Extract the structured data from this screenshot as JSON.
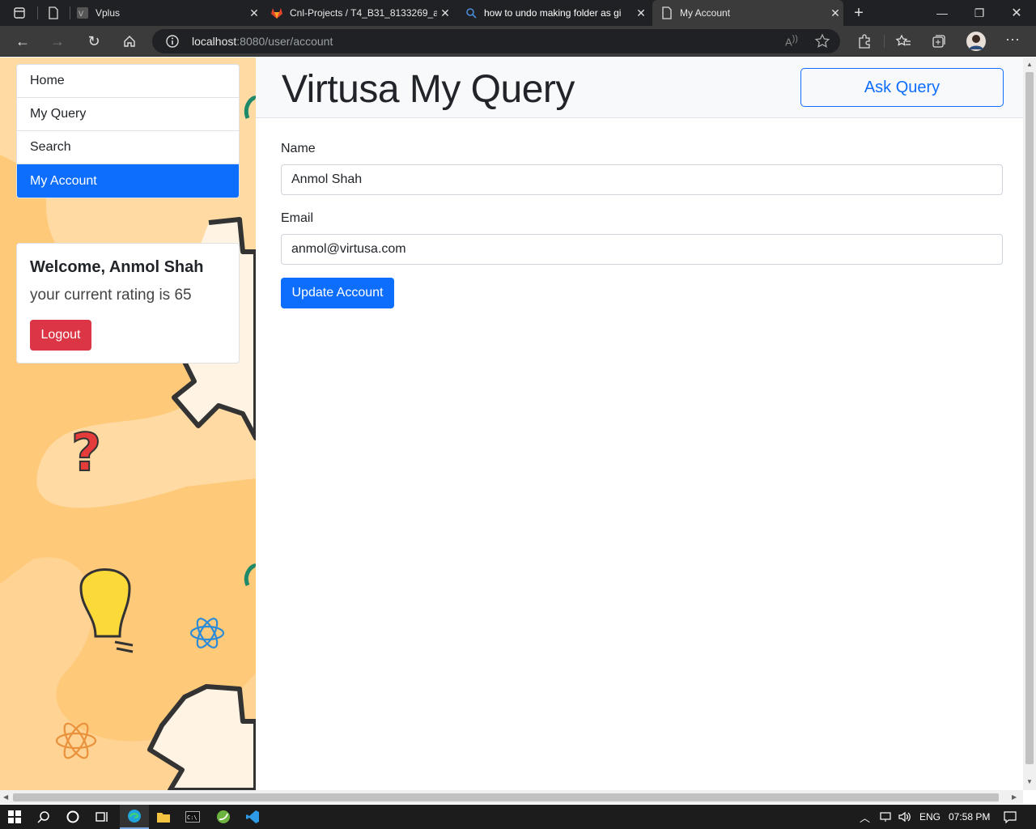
{
  "browser": {
    "tabs": [
      {
        "title": "Vplus",
        "icon": "vplus-icon"
      },
      {
        "title": "Cnl-Projects / T4_B31_8133269_a",
        "icon": "gitlab-icon"
      },
      {
        "title": "how to undo making folder as gi",
        "icon": "search-icon"
      },
      {
        "title": "My Account",
        "icon": "page-icon"
      }
    ],
    "url_host": "localhost",
    "url_path": ":8080/user/account"
  },
  "sidebar": {
    "items": [
      {
        "label": "Home"
      },
      {
        "label": "My Query"
      },
      {
        "label": "Search"
      },
      {
        "label": "My Account"
      }
    ],
    "active_index": 3
  },
  "welcome": {
    "title": "Welcome, Anmol Shah",
    "rating_text": "your current rating is 65",
    "logout_label": "Logout"
  },
  "header": {
    "brand": "Virtusa My Query",
    "ask_label": "Ask Query"
  },
  "form": {
    "name_label": "Name",
    "name_value": "Anmol Shah",
    "email_label": "Email",
    "email_value": "anmol@virtusa.com",
    "submit_label": "Update Account"
  },
  "taskbar": {
    "lang": "ENG",
    "time": "07:58 PM"
  },
  "colors": {
    "primary": "#0d6efd",
    "danger": "#dc3545",
    "sidebar_bg": "#ffc97a"
  }
}
